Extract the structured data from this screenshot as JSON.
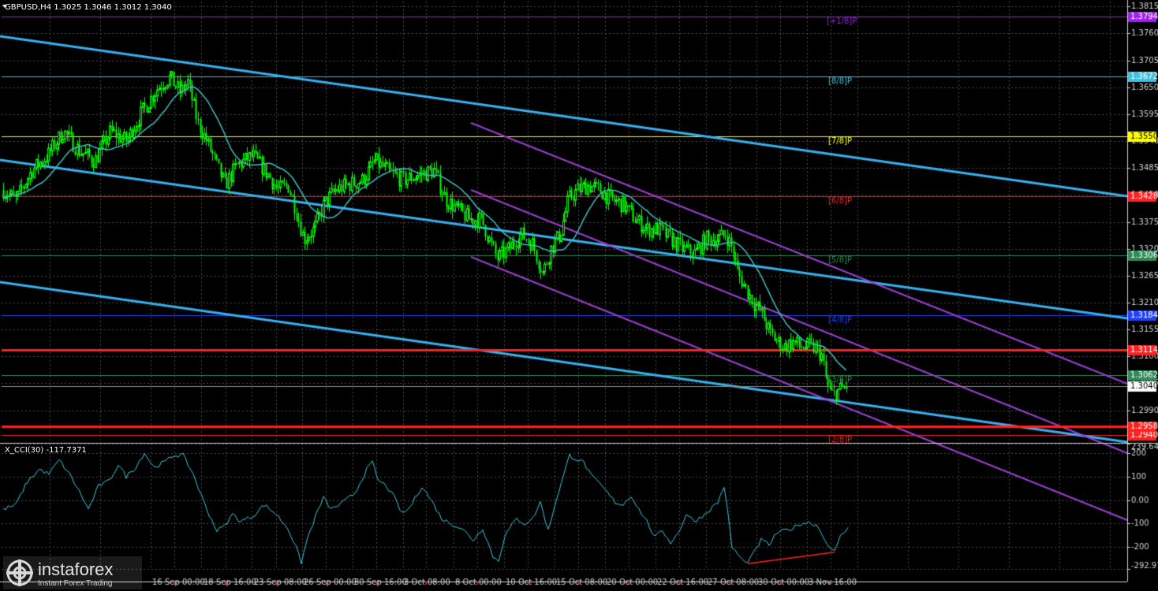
{
  "header": {
    "title": "GBPUSD,H4  1.3025 1.3046 1.3012 1.3040",
    "cci_title": "X_CCI(30) -117.7371"
  },
  "watermark": {
    "brand": "instaforex",
    "tagline": "Instant Forex Trading"
  },
  "colors": {
    "background": "#000000",
    "grid": "#4a4a4a",
    "axis": "#d0d0d0",
    "candle": "#00ff00",
    "ma": "#40c0c0",
    "channel_main": "#36b2f0",
    "channel_purple": "#9a3fd0",
    "cci": "#40c8e0",
    "divergence": "#ff2020",
    "support": "#ff2020"
  },
  "chart_data": [
    {
      "type": "candlestick",
      "symbol": "GBPUSD",
      "timeframe": "H4",
      "ohlc_last": {
        "open": 1.3025,
        "high": 1.3046,
        "low": 1.3012,
        "close": 1.304
      },
      "ylim": [
        1.2925,
        1.3825
      ],
      "y_ticks": [
        1.3815,
        1.376,
        1.3705,
        1.365,
        1.3595,
        1.354,
        1.3485,
        1.343,
        1.3375,
        1.332,
        1.3265,
        1.321,
        1.3155,
        1.31,
        1.3045,
        1.299
      ],
      "x_labels": [
        "16 Sep 00:00",
        "18 Sep 16:00",
        "23 Sep 08:00",
        "26 Sep 00:00",
        "30 Sep 16:00",
        "3 Oct 08:00",
        "8 Oct 00:00",
        "10 Oct 16:00",
        "15 Oct 08:00",
        "20 Oct 00:00",
        "22 Oct 16:00",
        "27 Oct 08:00",
        "30 Oct 00:00",
        "3 Nov 16:00"
      ],
      "murrey_levels": [
        {
          "label": "[+1/8]P",
          "value": 1.3794,
          "tag": "1.3794",
          "color": "#a020f0"
        },
        {
          "label": "[8/8]P",
          "value": 1.3672,
          "tag": "1.3672",
          "color": "#40c0e0"
        },
        {
          "label": "[7/8]P",
          "value": 1.355,
          "tag": "1.3550",
          "color": "#ffff00"
        },
        {
          "label": "[6/8]P",
          "value": 1.3428,
          "tag": "1.3428",
          "color": "#ff2020"
        },
        {
          "label": "[5/8]P",
          "value": 1.3306,
          "tag": "1.3306",
          "color": "#2e8b57"
        },
        {
          "label": "[4/8]P",
          "value": 1.3184,
          "tag": "1.3184",
          "color": "#2040ff"
        },
        {
          "label": "[3/8]P",
          "value": 1.3062,
          "tag": "1.3062",
          "color": "#2e8b57"
        },
        {
          "label": "[2/8]P",
          "value": 1.294,
          "tag": "1.2940",
          "color": "#ff2020"
        }
      ],
      "support_levels": [
        {
          "value": 1.3114,
          "tag": "1.3114"
        },
        {
          "value": 1.2958,
          "tag": "1.2958"
        }
      ],
      "current_price": {
        "value": 1.304,
        "tag": "1.3040"
      }
    },
    {
      "type": "line",
      "name": "X_CCI(30)",
      "ylim": [
        -292.972,
        239.6457
      ],
      "y_ticks_labels": [
        "239.6457",
        "200",
        "100",
        "0.00",
        "-100",
        "-200",
        "-292.972"
      ],
      "y_ticks_values": [
        239.6457,
        200,
        100,
        0,
        -100,
        -200,
        -292.972
      ]
    }
  ]
}
